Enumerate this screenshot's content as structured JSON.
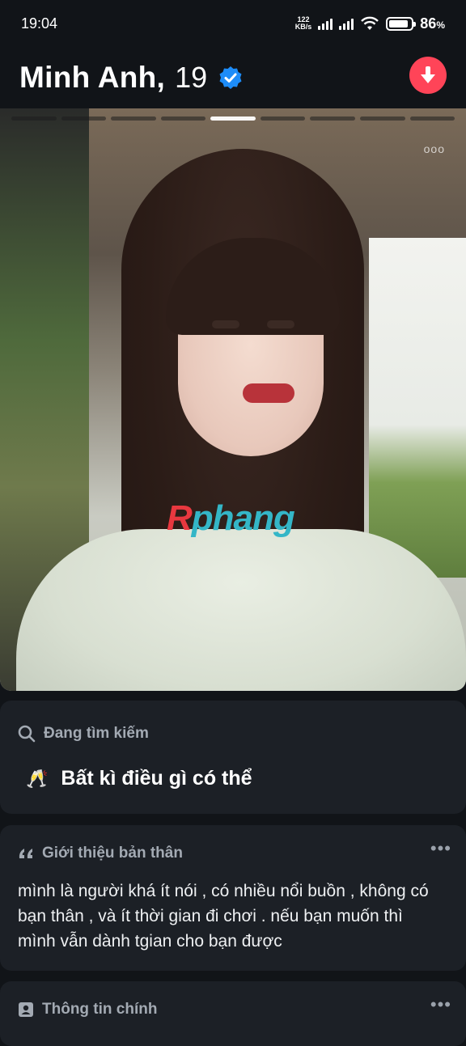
{
  "status_bar": {
    "time": "19:04",
    "net_speed_value": "122",
    "net_speed_unit": "KB/s",
    "battery_percent": "86",
    "battery_unit": "%",
    "battery_level": 0.86
  },
  "profile": {
    "name": "Minh Anh,",
    "age": "19",
    "verified": true
  },
  "photo": {
    "total_photos": 9,
    "active_index": 4,
    "watermark_first": "R",
    "watermark_rest": "phang",
    "menu_label": "ooo"
  },
  "looking_for": {
    "heading": "Đang tìm kiếm",
    "emoji": "🥂",
    "value": "Bất kì điều gì có thể"
  },
  "about": {
    "heading": "Giới thiệu bản thân",
    "text": "mình là người khá ít nói , có nhiều nổi buồn , không có bạn thân , và ít thời gian đi chơi . nếu bạn muốn thì mình vẫn dành tgian cho bạn được",
    "more": "•••"
  },
  "main_info": {
    "heading": "Thông tin chính",
    "more": "•••"
  },
  "colors": {
    "background": "#111418",
    "card": "#1c2026",
    "accent": "#ff4458",
    "verified": "#1d8cf8"
  }
}
